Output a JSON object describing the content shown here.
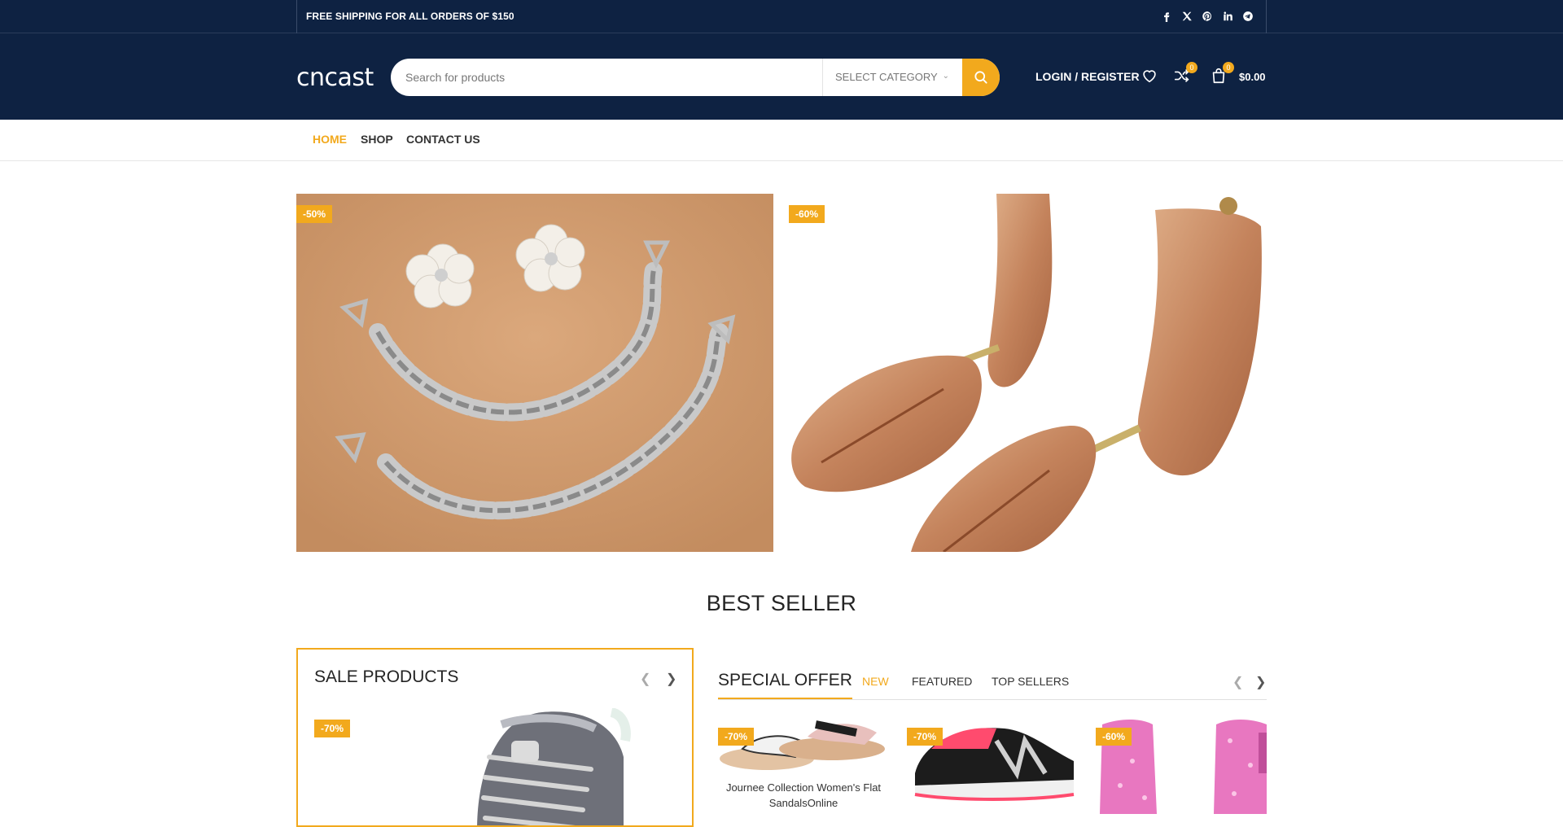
{
  "topbar": {
    "shipping_text": "FREE SHIPPING FOR ALL ORDERS OF $150",
    "socials": [
      "facebook-icon",
      "x-icon",
      "pinterest-icon",
      "linkedin-icon",
      "telegram-icon"
    ]
  },
  "header": {
    "logo": "cncast",
    "search_placeholder": "Search for products",
    "category_label": "SELECT CATEGORY",
    "login_label": "LOGIN / REGISTER",
    "compare_count": "0",
    "cart_count": "0",
    "cart_total": "$0.00"
  },
  "nav": {
    "items": [
      {
        "label": "HOME",
        "active": true
      },
      {
        "label": "SHOP",
        "active": false
      },
      {
        "label": "CONTACT US",
        "active": false
      }
    ]
  },
  "banners": [
    {
      "discount": "-50%"
    },
    {
      "discount": "-60%"
    }
  ],
  "best_seller": {
    "title": "BEST SELLER"
  },
  "sale_products": {
    "title": "SALE PRODUCTS",
    "items": [
      {
        "discount": "-70%"
      }
    ]
  },
  "special_offer": {
    "title": "SPECIAL OFFER",
    "tabs": [
      {
        "label": "NEW",
        "active": true
      },
      {
        "label": "FEATURED",
        "active": false
      },
      {
        "label": "TOP SELLERS",
        "active": false
      }
    ],
    "products": [
      {
        "discount": "-70%",
        "name": "Journee Collection Women's Flat SandalsOnline"
      },
      {
        "discount": "-70%",
        "name": ""
      },
      {
        "discount": "-60%",
        "name": ""
      }
    ]
  },
  "colors": {
    "navy": "#0e2242",
    "accent": "#f2a91d"
  }
}
